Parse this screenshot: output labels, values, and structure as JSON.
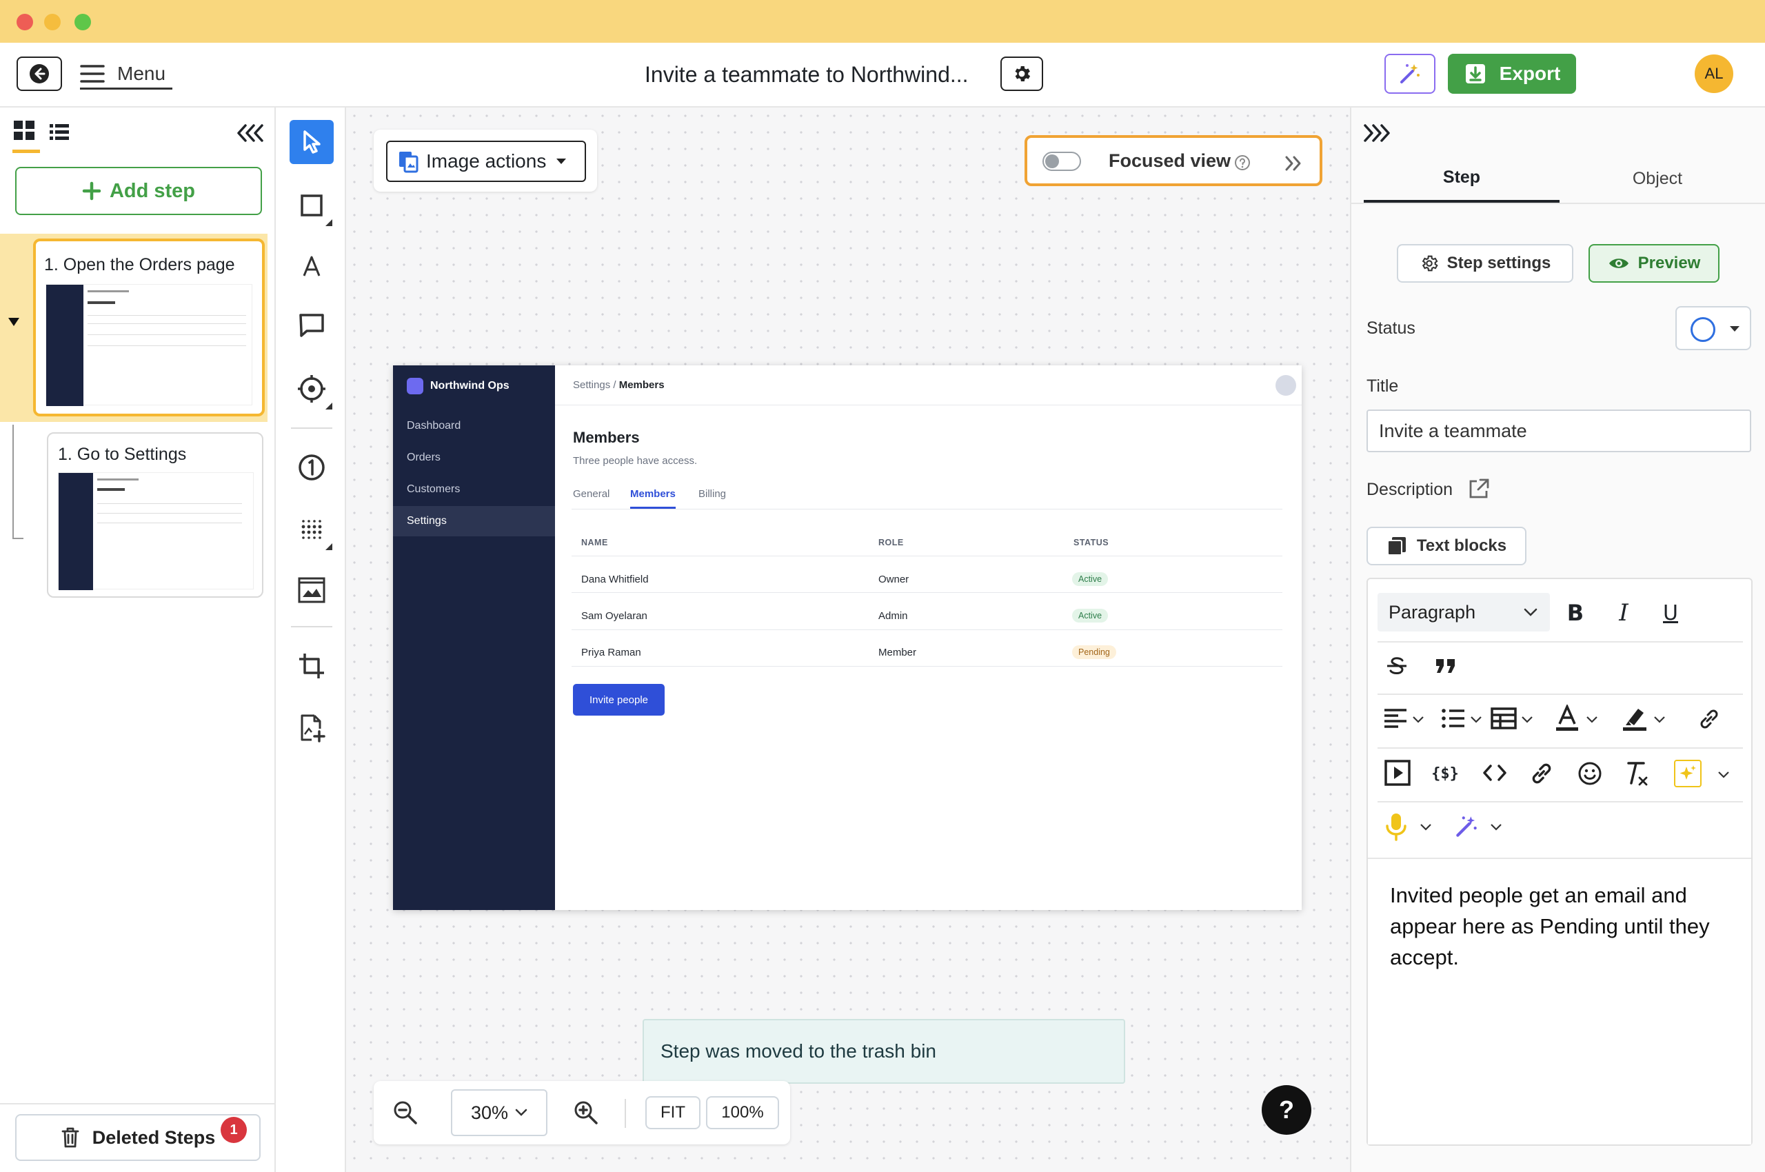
{
  "window": {
    "traffic_colors": [
      "#ee5d55",
      "#f5bd3e",
      "#5fc649"
    ],
    "titlebar_color": "#f9d77e"
  },
  "header": {
    "back_icon": "arrow-left-circle-icon",
    "menu_label": "Menu",
    "doc_title": "Invite a teammate to Northwind...",
    "settings_icon": "gear-icon",
    "magic_icon": "magic-wand-icon",
    "export_label": "Export",
    "avatar_initials": "AL",
    "accent_green": "#43a047"
  },
  "left_panel": {
    "view_toggle_icons": [
      "grid-view-icon",
      "list-view-icon"
    ],
    "collapse_icon": "chevrons-left-icon",
    "add_step_label": "Add step",
    "steps": [
      {
        "title": "1. Open the Orders page",
        "selected": true
      },
      {
        "title": "1. Go to Settings",
        "selected": false
      }
    ],
    "deleted_steps_label": "Deleted Steps",
    "deleted_count": "1"
  },
  "toolbar": {
    "tools": [
      "select-arrow-icon",
      "rectangle-icon",
      "text-icon",
      "comment-icon",
      "target-icon",
      "step-number-icon",
      "blur-icon",
      "image-frame-icon",
      "crop-icon",
      "add-image-icon"
    ]
  },
  "canvas": {
    "image_actions_label": "Image actions",
    "focused_view_label": "Focused view",
    "focused_view_enabled": false,
    "toast": "Step was moved to the trash bin",
    "zoom_value": "30%",
    "fit_label": "FIT",
    "full_label": "100%",
    "help_label": "?"
  },
  "screenshot": {
    "app_name": "Northwind Ops",
    "nav": [
      "Dashboard",
      "Orders",
      "Customers",
      "Settings"
    ],
    "active_nav": "Settings",
    "breadcrumb_parent": "Settings / ",
    "breadcrumb_current": "Members",
    "heading": "Members",
    "subheading": "Three people have access.",
    "tabs": [
      "General",
      "Members",
      "Billing"
    ],
    "active_tab": "Members",
    "columns": [
      "NAME",
      "ROLE",
      "STATUS"
    ],
    "rows": [
      {
        "name": "Dana Whitfield",
        "role": "Owner",
        "status": "Active"
      },
      {
        "name": "Sam Oyelaran",
        "role": "Admin",
        "status": "Active"
      },
      {
        "name": "Priya Raman",
        "role": "Member",
        "status": "Pending"
      }
    ],
    "invite_button": "Invite people"
  },
  "right_panel": {
    "expand_icon": "chevrons-right-icon",
    "tabs": [
      "Step",
      "Object"
    ],
    "active_tab": "Step",
    "step_settings_label": "Step settings",
    "preview_label": "Preview",
    "status_label": "Status",
    "title_label": "Title",
    "title_value": "Invite a teammate",
    "description_label": "Description",
    "text_blocks_label": "Text blocks",
    "paragraph_style": "Paragraph",
    "description_text": "Invited people get an email and appear here as Pending until they accept."
  }
}
